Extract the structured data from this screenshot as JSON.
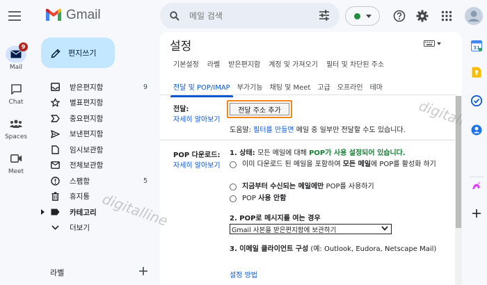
{
  "app": {
    "name": "Gmail"
  },
  "search": {
    "placeholder": "메일 검색"
  },
  "rail": {
    "mail": {
      "label": "Mail",
      "badge": "9"
    },
    "chat": {
      "label": "Chat"
    },
    "spaces": {
      "label": "Spaces"
    },
    "meet": {
      "label": "Meet"
    }
  },
  "sidebar": {
    "compose_label": "편지쓰기",
    "items": [
      {
        "label": "받은편지함",
        "count": "9",
        "icon": "inbox-icon"
      },
      {
        "label": "별표편지함",
        "count": "",
        "icon": "star-icon"
      },
      {
        "label": "중요편지함",
        "count": "",
        "icon": "important-icon"
      },
      {
        "label": "보낸편지함",
        "count": "",
        "icon": "send-icon"
      },
      {
        "label": "임시보관함",
        "count": "",
        "icon": "draft-icon"
      },
      {
        "label": "전체보관함",
        "count": "",
        "icon": "all-mail-icon"
      },
      {
        "label": "스팸함",
        "count": "5",
        "icon": "spam-icon"
      },
      {
        "label": "휴지통",
        "count": "",
        "icon": "trash-icon"
      },
      {
        "label": "카테고리",
        "count": "",
        "icon": "label-icon"
      },
      {
        "label": "더보기",
        "count": "",
        "icon": "chevron-down-icon"
      }
    ],
    "labels_title": "라벨"
  },
  "settings": {
    "title": "설정",
    "tabs_row1": [
      "기본설정",
      "라벨",
      "받은편지함",
      "계정 및 가져오기",
      "필터 및 차단된 주소"
    ],
    "tabs_row2": [
      "전달 및 POP/IMAP",
      "부가기능",
      "채팅 및 Meet",
      "고급",
      "오프라인",
      "테마"
    ],
    "active_tab": "전달 및 POP/IMAP",
    "forwarding": {
      "label": "전달:",
      "learn_more": "자세히 알아보기",
      "add_button": "전달 주소 추가",
      "tip_prefix": "도움말: ",
      "tip_link": "필터를 만들면",
      "tip_suffix": " 메일 중 일부만 전달할 수도 있습니다."
    },
    "pop": {
      "label": "POP 다운로드:",
      "learn_more": "자세히 알아보기",
      "status_num": "1. 상태: ",
      "status_text": "모든 메일에 대해 ",
      "status_green": "POP가 사용 설정되어 있습니다.",
      "option1_a": "이미 다운로드 된 메일을 포함하여 ",
      "option1_b": "모든 메일",
      "option1_c": "에 POP를 활성화 하기",
      "option2_a": "지금부터 수신되는 메일에만",
      "option2_b": " POP를 사용하기",
      "option3_a": "POP ",
      "option3_b": "사용 안함",
      "step2": "2. POP로 메시지를 여는 경우",
      "step2_select": "Gmail 사본을 받은편지함에 보관하기",
      "step3_bold": "3. 이메일 클라이언트 구성",
      "step3_text": " (예: Outlook, Eudora, Netscape Mail)",
      "setup_link": "설정 방법"
    }
  },
  "watermarks": [
    "digitalline",
    "digitalline"
  ],
  "colors": {
    "accent": "#0b57d0",
    "compose": "#c2e7ff",
    "highlight": "#f08519",
    "pop_enabled": "#188038",
    "badge": "#b3261e"
  }
}
